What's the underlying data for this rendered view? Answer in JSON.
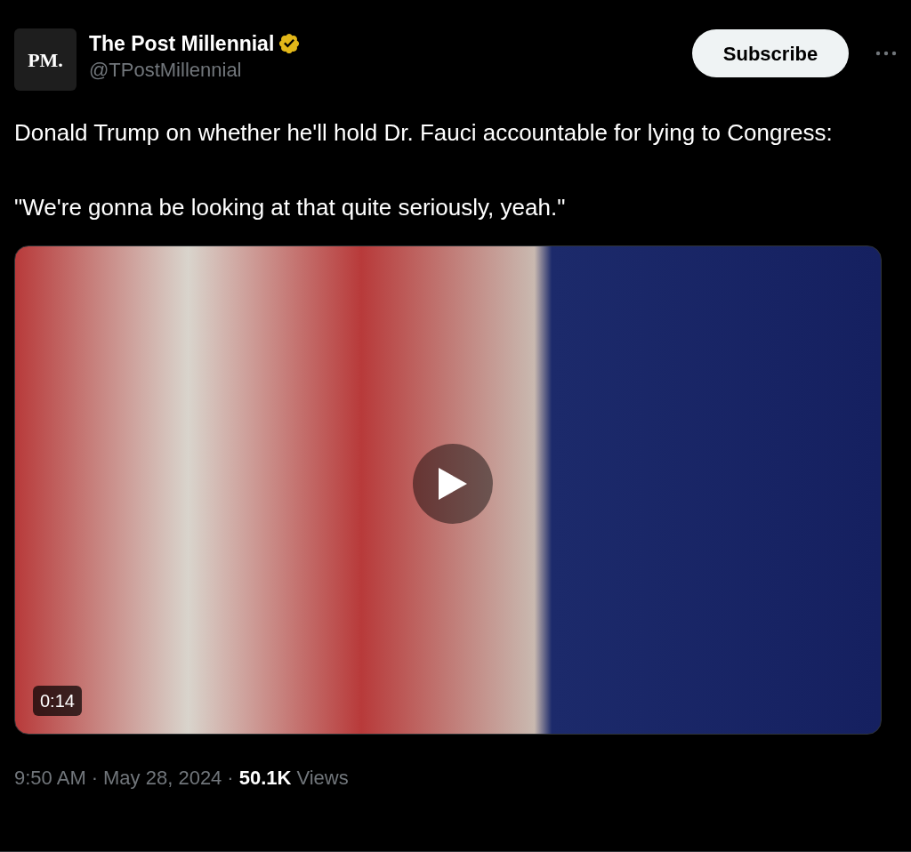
{
  "account": {
    "avatar_text": "PM.",
    "name": "The Post Millennial",
    "verified": true,
    "handle": "@TPostMillennial"
  },
  "subscribe_button": "Subscribe",
  "paragraphs": [
    "Donald Trump on whether he'll hold Dr. Fauci accountable for lying to Congress:",
    "\"We're gonna be looking at that quite seriously, yeah.\""
  ],
  "video": {
    "duration": "0:14"
  },
  "meta": {
    "time": "9:50 AM",
    "date": "May 28, 2024",
    "views_count": "50.1K",
    "views_label": "Views",
    "separators": [
      "·",
      "·"
    ]
  }
}
